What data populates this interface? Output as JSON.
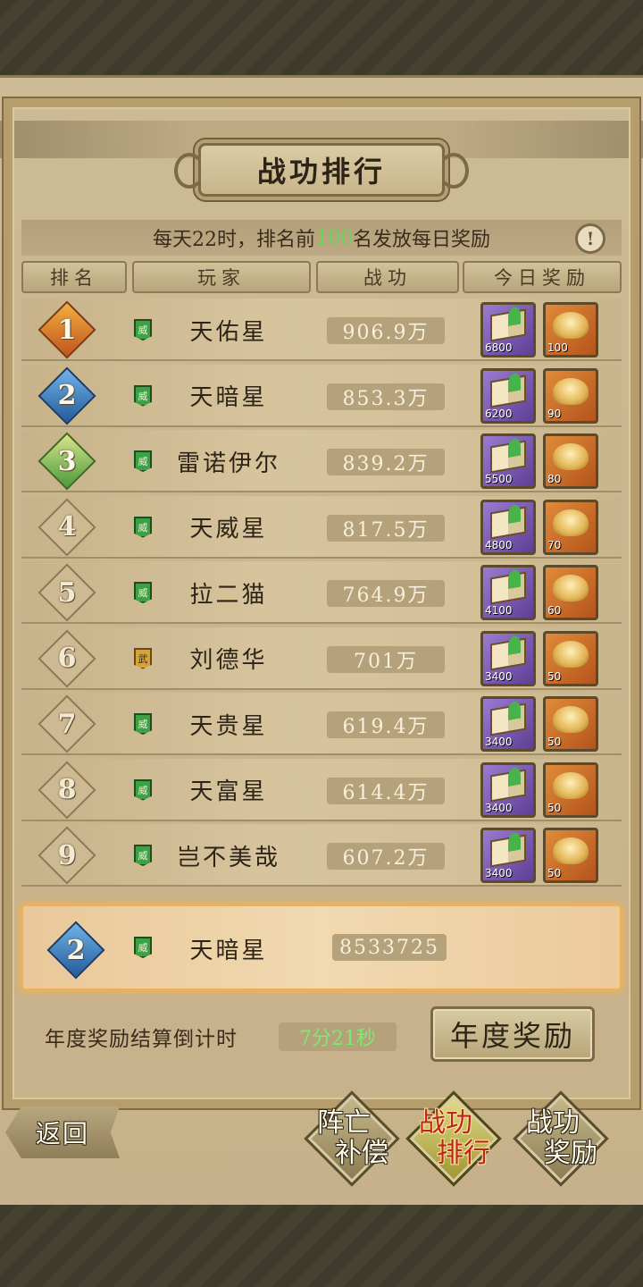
{
  "title": "战功排行",
  "notice": {
    "prefix": "每天22时，排名前",
    "highlight": "100",
    "suffix": "名发放每日奖励",
    "info_icon": "!"
  },
  "columns": [
    "排名",
    "玩家",
    "战功",
    "今日奖励"
  ],
  "rows": [
    {
      "rank": "1",
      "badge": "gold",
      "title_icon": "green",
      "name": "天佑星",
      "power": "906.9万",
      "book_qty": "6800",
      "gold_qty": "100"
    },
    {
      "rank": "2",
      "badge": "blue",
      "title_icon": "green",
      "name": "天暗星",
      "power": "853.3万",
      "book_qty": "6200",
      "gold_qty": "90"
    },
    {
      "rank": "3",
      "badge": "green",
      "title_icon": "green",
      "name": "雷诺伊尔",
      "power": "839.2万",
      "book_qty": "5500",
      "gold_qty": "80"
    },
    {
      "rank": "4",
      "badge": "plain",
      "title_icon": "green",
      "name": "天威星",
      "power": "817.5万",
      "book_qty": "4800",
      "gold_qty": "70"
    },
    {
      "rank": "5",
      "badge": "plain",
      "title_icon": "green",
      "name": "拉二猫",
      "power": "764.9万",
      "book_qty": "4100",
      "gold_qty": "60"
    },
    {
      "rank": "6",
      "badge": "plain",
      "title_icon": "gold",
      "name": "刘德华",
      "power": "701万",
      "book_qty": "3400",
      "gold_qty": "50"
    },
    {
      "rank": "7",
      "badge": "plain",
      "title_icon": "green",
      "name": "天贵星",
      "power": "619.4万",
      "book_qty": "3400",
      "gold_qty": "50"
    },
    {
      "rank": "8",
      "badge": "plain",
      "title_icon": "green",
      "name": "天富星",
      "power": "614.4万",
      "book_qty": "3400",
      "gold_qty": "50"
    },
    {
      "rank": "9",
      "badge": "plain",
      "title_icon": "green",
      "name": "岂不美哉",
      "power": "607.2万",
      "book_qty": "3400",
      "gold_qty": "50"
    }
  ],
  "my_row": {
    "rank": "2",
    "badge": "blue",
    "title_icon": "green",
    "name": "天暗星",
    "power": "8533725"
  },
  "countdown": {
    "label": "年度奖励结算倒计时",
    "value": "7分21秒"
  },
  "annual_button": "年度奖励",
  "back_button": "返回",
  "tabs": [
    {
      "line1": "阵亡",
      "line2": "补偿",
      "active": false
    },
    {
      "line1": "战功",
      "line2": "排行",
      "active": true
    },
    {
      "line1": "战功",
      "line2": "奖励",
      "active": false
    }
  ],
  "colors": {
    "accent_green": "#69d65a",
    "active_tab_text": "#c0251a",
    "highlight_border": "#f2b04c"
  }
}
